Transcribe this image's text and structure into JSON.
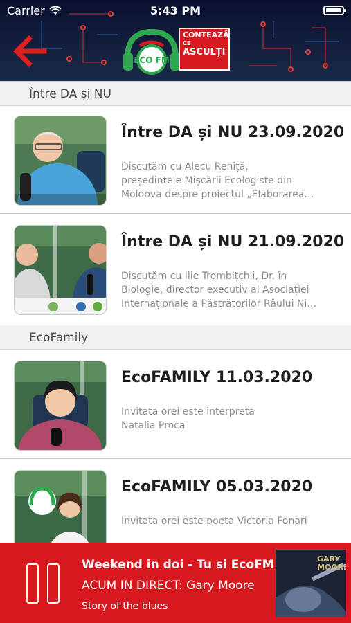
{
  "status_bar": {
    "carrier": "Carrier",
    "time": "5:43 PM"
  },
  "header": {
    "logo": {
      "line1": "CONTEAZĂ",
      "line2": "CE",
      "line3": "ASCULȚI",
      "badge": "ECO FM"
    }
  },
  "sections": [
    {
      "title": "Între DA și NU",
      "items": [
        {
          "title": "Între DA și NU 23.09.2020",
          "desc_lines": [
            "Discutăm cu Alecu Reniță,",
            "președintele Mișcării Ecologiste din",
            "Moldova despre proiectul „Elaborarea…"
          ]
        },
        {
          "title": "Între DA și NU 21.09.2020",
          "desc_lines": [
            "Discutăm cu Ilie Trombițchii, Dr. în",
            "Biologie, director executiv al Asociației",
            "Internaționale a Păstrătorilor Râului Ni…"
          ]
        }
      ]
    },
    {
      "title": "EcoFamily",
      "items": [
        {
          "title": "EcoFAMILY 11.03.2020",
          "desc_lines": [
            "Invitata orei este interpreta",
            "Natalia Proca"
          ]
        },
        {
          "title": "EcoFAMILY 05.03.2020",
          "desc_lines": [
            "Invitata orei este poeta Victoria Fonari"
          ]
        }
      ]
    }
  ],
  "player": {
    "show_title": "Weekend in doi - Tu si EcoFM",
    "live_label": "ACUM IN DIRECT: Gary Moore",
    "song": "Story of the blues",
    "album_art_text": "GARY MOORE",
    "album_art_icon": "guitar-album-art"
  },
  "colors": {
    "accent_red": "#d7191f",
    "header_bg": "#0f1834",
    "logo_green": "#2fa84f"
  },
  "icons": {
    "back": "back-arrow-icon",
    "pause": "pause-icon",
    "wifi": "wifi-icon",
    "battery": "battery-icon"
  }
}
